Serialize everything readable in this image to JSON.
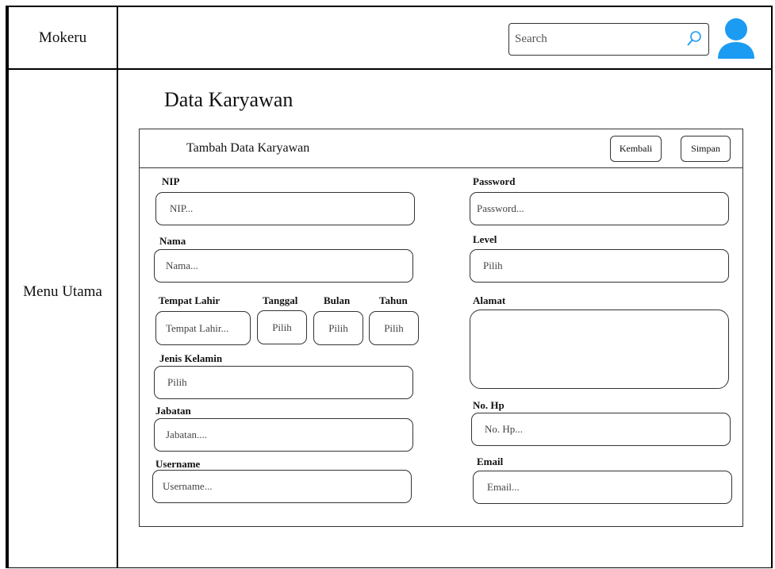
{
  "brand": "Mokeru",
  "menu_label": "Menu Utama",
  "search": {
    "placeholder": "Search"
  },
  "page_title": "Data Karyawan",
  "panel": {
    "title": "Tambah Data Karyawan",
    "back_label": "Kembali",
    "save_label": "Simpan"
  },
  "form": {
    "nip": {
      "label": "NIP",
      "placeholder": "NIP..."
    },
    "nama": {
      "label": "Nama",
      "placeholder": "Nama..."
    },
    "tempat_lahir": {
      "label": "Tempat Lahir",
      "placeholder": "Tempat Lahir..."
    },
    "tanggal": {
      "label": "Tanggal",
      "value": "Pilih"
    },
    "bulan": {
      "label": "Bulan",
      "value": "Pilih"
    },
    "tahun": {
      "label": "Tahun",
      "value": "Pilih"
    },
    "jenis_kelamin": {
      "label": "Jenis Kelamin",
      "value": "Pilih"
    },
    "jabatan": {
      "label": "Jabatan",
      "placeholder": "Jabatan...."
    },
    "username": {
      "label": "Username",
      "placeholder": "Username..."
    },
    "password": {
      "label": "Password",
      "placeholder": "Password..."
    },
    "level": {
      "label": "Level",
      "value": "Pilih"
    },
    "alamat": {
      "label": "Alamat",
      "placeholder": ""
    },
    "no_hp": {
      "label": "No. Hp",
      "placeholder": "No. Hp..."
    },
    "email": {
      "label": "Email",
      "placeholder": "Email..."
    }
  },
  "colors": {
    "avatar": "#1b9cf2",
    "border": "#333333"
  },
  "icons": {
    "search": "search-icon",
    "avatar": "user-avatar-icon"
  }
}
